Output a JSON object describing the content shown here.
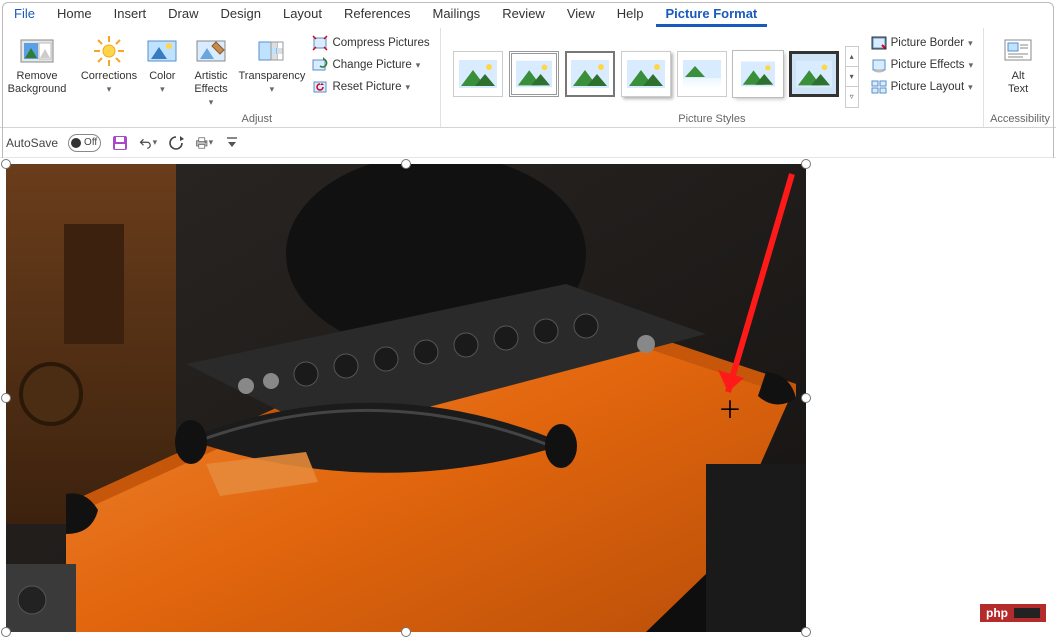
{
  "tabs": {
    "file": "File",
    "home": "Home",
    "insert": "Insert",
    "draw": "Draw",
    "design": "Design",
    "layout": "Layout",
    "references": "References",
    "mailings": "Mailings",
    "review": "Review",
    "view": "View",
    "help": "Help",
    "picture_format": "Picture Format"
  },
  "ribbon": {
    "remove_bg": "Remove\nBackground",
    "corrections": "Corrections",
    "color": "Color",
    "artistic": "Artistic\nEffects",
    "transparency": "Transparency",
    "compress": "Compress Pictures",
    "change": "Change Picture",
    "reset": "Reset Picture",
    "group_adjust": "Adjust",
    "group_styles": "Picture Styles",
    "group_acc": "Accessibility",
    "border": "Picture Border",
    "effects": "Picture Effects",
    "layout": "Picture Layout",
    "alt": "Alt\nText"
  },
  "qat": {
    "autosave": "AutoSave",
    "off": "Off"
  },
  "watermark": "php"
}
